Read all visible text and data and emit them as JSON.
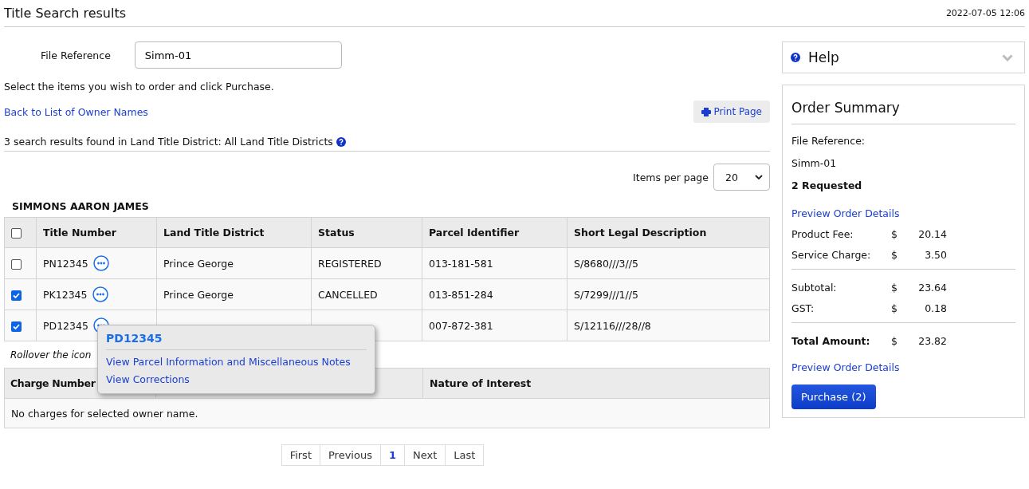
{
  "header": {
    "title": "Title Search results",
    "datetime": "2022-07-05 12:06"
  },
  "file_reference": {
    "label": "File Reference",
    "value": "Simm-01"
  },
  "instruction": "Select the items you wish to order and click Purchase.",
  "back_link": "Back to List of Owner Names",
  "print_button": "Print Page",
  "results_summary": "3 search results found in Land Title District: All Land Title Districts",
  "items_per_page": {
    "label": "Items per page",
    "value": "20"
  },
  "owner_name": "SIMMONS AARON JAMES",
  "titles_table": {
    "select_all_checked": false,
    "columns": [
      "Title Number",
      "Land Title District",
      "Status",
      "Parcel Identifier",
      "Short Legal Description"
    ],
    "rows": [
      {
        "checked": false,
        "title_number": "PN12345",
        "district": "Prince George",
        "status": "REGISTERED",
        "pid": "013-181-581",
        "legal": "S/8680///3//5"
      },
      {
        "checked": true,
        "title_number": "PK12345",
        "district": "Prince George",
        "status": "CANCELLED",
        "pid": "013-851-284",
        "legal": "S/7299///1//5"
      },
      {
        "checked": true,
        "title_number": "PD12345",
        "pid": "007-872-381",
        "legal": "S/12116///28//8",
        "popup": {
          "title": "PD12345",
          "links": [
            "View Parcel Information and Miscellaneous Notes",
            "View Corrections"
          ]
        }
      }
    ]
  },
  "rollover_note": "Rollover the icon",
  "charges_table": {
    "columns": [
      {
        "label": "Charge Number"
      },
      {},
      {
        "label": "Nature of Interest"
      }
    ],
    "empty_message": "No charges for selected owner name."
  },
  "pagination": [
    {
      "label": "First",
      "selected": false
    },
    {
      "label": "Previous",
      "selected": false
    },
    {
      "label": "1",
      "selected": true
    },
    {
      "label": "Next",
      "selected": false
    },
    {
      "label": "Last",
      "selected": false
    }
  ],
  "help": {
    "title": "Help",
    "expanded": false
  },
  "order_summary": {
    "title": "Order Summary",
    "file_reference_label": "File Reference:",
    "file_reference": "Simm-01",
    "requested": "2 Requested",
    "preview_link_top": "Preview Order Details",
    "fees": [
      {
        "label": "Product Fee:",
        "currency": "$",
        "amount": "20.14"
      },
      {
        "label": "Service Charge:",
        "currency": "$",
        "amount": "3.50"
      }
    ],
    "subtotals": [
      {
        "label": "Subtotal:",
        "currency": "$",
        "amount": "23.64"
      },
      {
        "label": "GST:",
        "currency": "$",
        "amount": "0.18"
      }
    ],
    "total": {
      "label": "Total Amount:",
      "currency": "$",
      "amount": "23.82"
    },
    "preview_link_bottom": "Preview Order Details",
    "purchase_button": "Purchase (2)"
  }
}
